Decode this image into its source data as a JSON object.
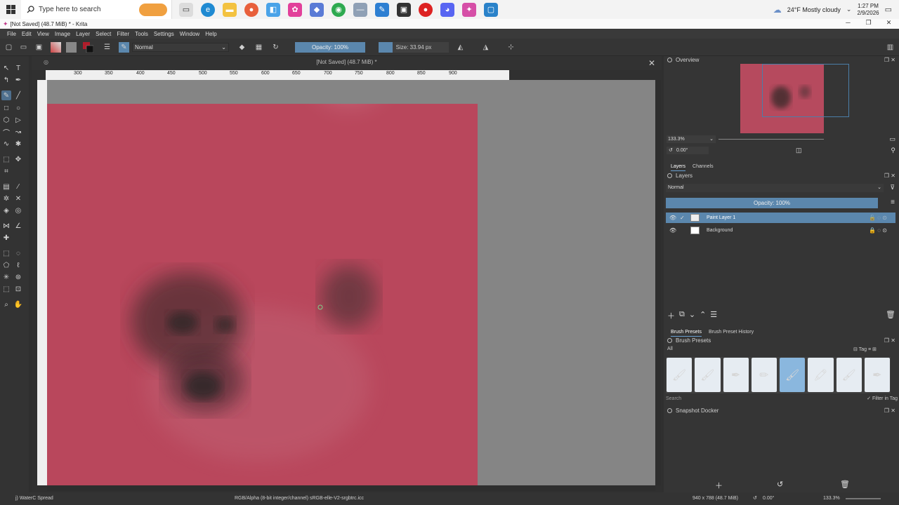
{
  "taskbar": {
    "search_placeholder": "Type here to search",
    "weather": "24°F  Mostly cloudy",
    "time": "1:27 PM",
    "date": "2/9/2026"
  },
  "window": {
    "title": "[Not Saved] (48.7 MiB) * - Krita"
  },
  "menu": [
    "File",
    "Edit",
    "View",
    "Image",
    "Layer",
    "Select",
    "Filter",
    "Tools",
    "Settings",
    "Window",
    "Help"
  ],
  "toolbar": {
    "blend_mode": "Normal",
    "opacity_label": "Opacity: 100%",
    "size_label": "Size: 33.94 px",
    "size_fraction": 0.2
  },
  "canvas": {
    "doc_title": "[Not Saved]  (48.7 MiB) *",
    "ruler_labels": [
      "300",
      "350",
      "400",
      "450",
      "500",
      "550",
      "600",
      "650",
      "700",
      "750",
      "800",
      "850",
      "900"
    ]
  },
  "dockers": {
    "overview_title": "Overview",
    "zoom": "133.3%",
    "rotation": "0.00°",
    "tabs": [
      "Layers",
      "Channels"
    ],
    "layers_title": "Layers",
    "layer_blend": "Normal",
    "layer_opacity": "Opacity:  100%",
    "layers": [
      {
        "name": "Paint Layer 1",
        "selected": true
      },
      {
        "name": "Background",
        "selected": false
      }
    ],
    "preset_tabs": [
      "Brush Presets",
      "Brush Preset History"
    ],
    "presets_title": "Brush Presets",
    "preset_filter": "All",
    "preset_tag": "Tag",
    "preset_search": "Search",
    "filter_in_tag": "Filter in Tag",
    "snapshot_title": "Snapshot Docker"
  },
  "status": {
    "brush": "j) WaterC Spread",
    "color_space": "RGB/Alpha (8-bit integer/channel)  sRGB-elle-V2-srgbtrc.icc",
    "dimensions": "940 x 788 (48.7 MiB)",
    "rotation": "0.00°",
    "zoom": "133.3%"
  },
  "colors": {
    "accent": "#5b87ad",
    "canvas_paint": "#b9475c",
    "dark_mark": "#3e2a2c"
  }
}
